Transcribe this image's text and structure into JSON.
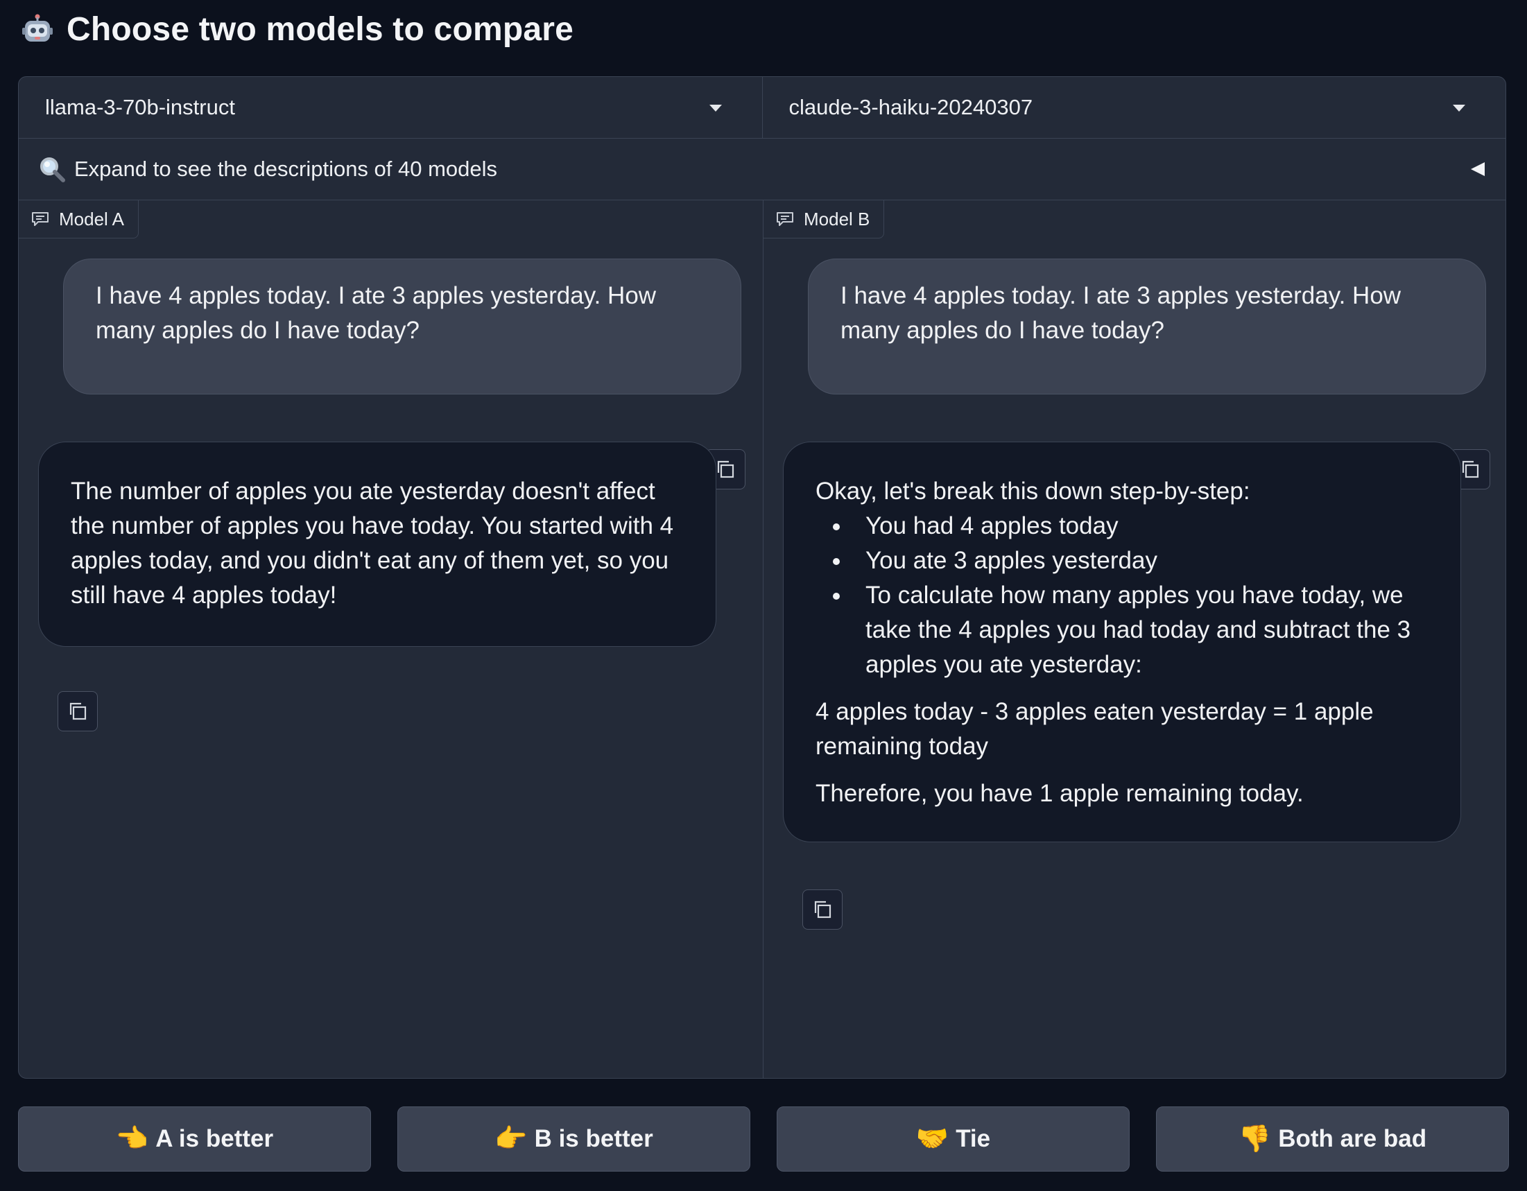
{
  "header": {
    "icon": "robot-icon",
    "title": "Choose two models to compare"
  },
  "models": {
    "a": {
      "selected": "llama-3-70b-instruct"
    },
    "b": {
      "selected": "claude-3-haiku-20240307"
    }
  },
  "expand": {
    "icon": "magnifier-icon",
    "text": "Expand to see the descriptions of 40 models"
  },
  "chat_a": {
    "label": "Model A",
    "user_message": "I have 4 apples today. I ate 3 apples yesterday. How many apples do I have today?",
    "bot_message": "The number of apples you ate yesterday doesn't affect the number of apples you have today. You started with 4 apples today, and you didn't eat any of them yet, so you still have 4 apples today!"
  },
  "chat_b": {
    "label": "Model B",
    "user_message": "I have 4 apples today. I ate 3 apples yesterday. How many apples do I have today?",
    "bot_intro": "Okay, let's break this down step-by-step:",
    "bot_bullets": [
      "You had 4 apples today",
      "You ate 3 apples yesterday",
      "To calculate how many apples you have today, we take the 4 apples you had today and subtract the 3 apples you ate yesterday:"
    ],
    "bot_equation": "4 apples today - 3 apples eaten yesterday = 1 apple remaining today",
    "bot_conclusion": "Therefore, you have 1 apple remaining today."
  },
  "votes": [
    {
      "emoji": "👈",
      "label": "A is better"
    },
    {
      "emoji": "👉",
      "label": "B is better"
    },
    {
      "emoji": "🤝",
      "label": "Tie"
    },
    {
      "emoji": "👎",
      "label": "Both are bad"
    }
  ],
  "colors": {
    "background": "#0c111d",
    "panel": "#232a38",
    "user_bubble": "#3b4252",
    "bot_bubble": "#121826"
  }
}
